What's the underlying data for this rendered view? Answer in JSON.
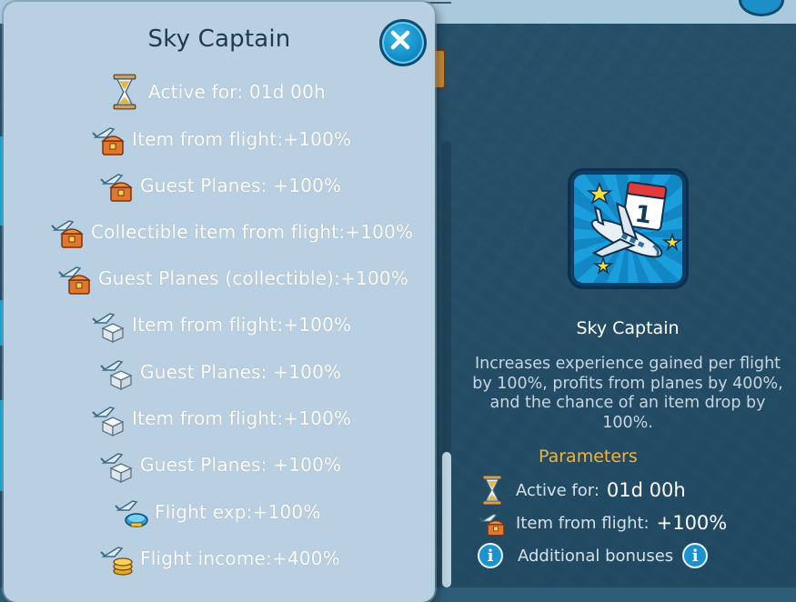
{
  "popup": {
    "title": "Sky Captain",
    "close_icon": "close-icon",
    "rows": [
      {
        "icon": "hourglass-icon",
        "text": "Active for: 01d 00h"
      },
      {
        "icon": "plane-chest-icon",
        "text": "Item from flight:+100%"
      },
      {
        "icon": "plane-chest-icon",
        "text": "Guest Planes: +100%"
      },
      {
        "icon": "plane-chest-icon",
        "text": "Collectible item from flight:+100%"
      },
      {
        "icon": "plane-chest-icon",
        "text": "Guest Planes (collectible):+100%"
      },
      {
        "icon": "plane-box-icon",
        "text": "Item from flight:+100%"
      },
      {
        "icon": "plane-box-icon",
        "text": "Guest Planes: +100%"
      },
      {
        "icon": "plane-box-icon",
        "text": "Item from flight:+100%"
      },
      {
        "icon": "plane-box-icon",
        "text": "Guest Planes: +100%"
      },
      {
        "icon": "plane-exp-icon",
        "text": "Flight exp:+100%"
      },
      {
        "icon": "plane-coins-icon",
        "text": "Flight income:+400%"
      }
    ]
  },
  "reward": {
    "badge_icon": "sky-captain-badge-icon",
    "calendar_day": "1",
    "name": "Sky Captain",
    "description": "Increases experience gained per flight by 100%, profits from planes by 400%, and the chance of an item drop by 100%."
  },
  "parameters": {
    "title": "Parameters",
    "active_label": "Active for:",
    "active_value": "01d 00h",
    "item_label": "Item from flight:",
    "item_value": "+100%",
    "additional_label": "Additional bonuses",
    "info_glyph": "i"
  },
  "colors": {
    "popup_bg": "#b9cfe2",
    "accent_blue": "#138dc7",
    "params_title": "#f0b43c"
  }
}
